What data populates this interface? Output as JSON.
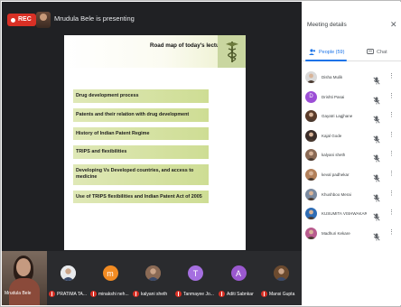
{
  "meeting": {
    "rec_label": "REC",
    "presenting_text": "Mrudula Bele is presenting"
  },
  "slide": {
    "title": "Road map of today's lecture",
    "agenda": [
      "Drug development process",
      "Patents and their relation with drug development",
      "History of Indian Patent Regime",
      "TRIPS and flexibilities",
      "Developing Vs Developed countries, and access to medicine",
      "Use of TRIPS flexibilities and Indian Patent Act of 2005"
    ]
  },
  "strip": {
    "self_name": "Mrudula Bele",
    "tiles": [
      {
        "name": "PRATIMA TA...",
        "initial": "",
        "color": "#e8eaed"
      },
      {
        "name": "minakshi neh...",
        "initial": "m",
        "color": "#f28b22"
      },
      {
        "name": "kalyani sheth",
        "initial": "",
        "color": "#8a6a55"
      },
      {
        "name": "Tanmayee Jo...",
        "initial": "T",
        "color": "#a56fe0"
      },
      {
        "name": "Aditi Sabnkar",
        "initial": "A",
        "color": "#9b59d0"
      },
      {
        "name": "Mansi Gupta",
        "initial": "",
        "color": "#6b4a2f"
      }
    ]
  },
  "panel": {
    "title": "Meeting details",
    "close_icon": "close-icon",
    "tab_people": "People (59)",
    "tab_chat": "Chat",
    "people": [
      {
        "name": "Disha Mulik",
        "initial": "",
        "color": "#d9d9d9"
      },
      {
        "name": "Drishti Pasai",
        "initial": "D",
        "color": "#9c4ed6"
      },
      {
        "name": "Gayatri Lagjhane",
        "initial": "",
        "color": "#5a3c2b"
      },
      {
        "name": "Kajal Gode",
        "initial": "",
        "color": "#3b2e2a"
      },
      {
        "name": "kalyani sheth",
        "initial": "",
        "color": "#8a6a55"
      },
      {
        "name": "keval padhekar",
        "initial": "",
        "color": "#b2805a"
      },
      {
        "name": "Khushboo Merai",
        "initial": "",
        "color": "#7a8aa0"
      },
      {
        "name": "KUSUMITA VISHWAKAR...",
        "initial": "",
        "color": "#2f6db5"
      },
      {
        "name": "Madhuri Kekare",
        "initial": "",
        "color": "#b85b8e"
      }
    ]
  },
  "colors": {
    "rec": "#d93025",
    "accent": "#1a73e8",
    "stage_bg": "#202124",
    "agenda_fill": "#d5e2a3"
  }
}
